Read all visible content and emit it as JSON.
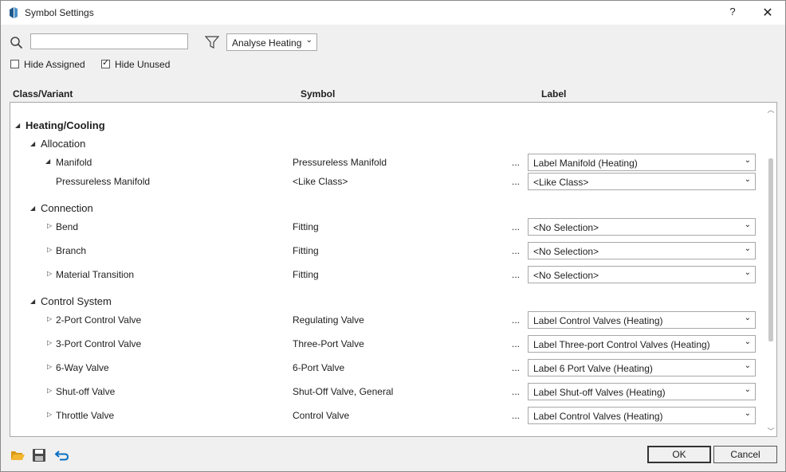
{
  "window": {
    "title": "Symbol Settings",
    "help": "?",
    "close": "✕"
  },
  "toolbar": {
    "search_value": "",
    "filter_value": "Analyse Heating",
    "hide_assigned": {
      "label": "Hide Assigned",
      "checked": false
    },
    "hide_unused": {
      "label": "Hide Unused",
      "checked": true
    }
  },
  "columns": {
    "class": "Class/Variant",
    "symbol": "Symbol",
    "label": "Label"
  },
  "tree": {
    "root": "Heating/Cooling",
    "allocation": {
      "title": "Allocation",
      "rows": [
        {
          "name": "Manifold",
          "symbol": "Pressureless Manifold",
          "label": "Label Manifold (Heating)"
        },
        {
          "name": "Pressureless Manifold",
          "symbol": "<Like Class>",
          "label": "<Like Class>"
        }
      ]
    },
    "connection": {
      "title": "Connection",
      "rows": [
        {
          "name": "Bend",
          "symbol": "Fitting",
          "label": "<No Selection>"
        },
        {
          "name": "Branch",
          "symbol": "Fitting",
          "label": "<No Selection>"
        },
        {
          "name": "Material Transition",
          "symbol": "Fitting",
          "label": "<No Selection>"
        }
      ]
    },
    "control": {
      "title": "Control System",
      "rows": [
        {
          "name": "2-Port Control Valve",
          "symbol": "Regulating Valve",
          "label": "Label Control Valves (Heating)"
        },
        {
          "name": "3-Port Control Valve",
          "symbol": "Three-Port Valve",
          "label": "Label Three-port Control Valves (Heating)"
        },
        {
          "name": "6-Way Valve",
          "symbol": "6-Port Valve",
          "label": "Label 6 Port Valve (Heating)"
        },
        {
          "name": "Shut-off Valve",
          "symbol": "Shut-Off Valve, General",
          "label": "Label Shut-off Valves (Heating)"
        },
        {
          "name": "Throttle Valve",
          "symbol": "Control Valve",
          "label": "Label Control Valves (Heating)"
        }
      ]
    },
    "ellipsis": "..."
  },
  "footer": {
    "ok": "OK",
    "cancel": "Cancel"
  },
  "colors": {
    "accent": "#0066cc",
    "folder": "#e8a317"
  }
}
